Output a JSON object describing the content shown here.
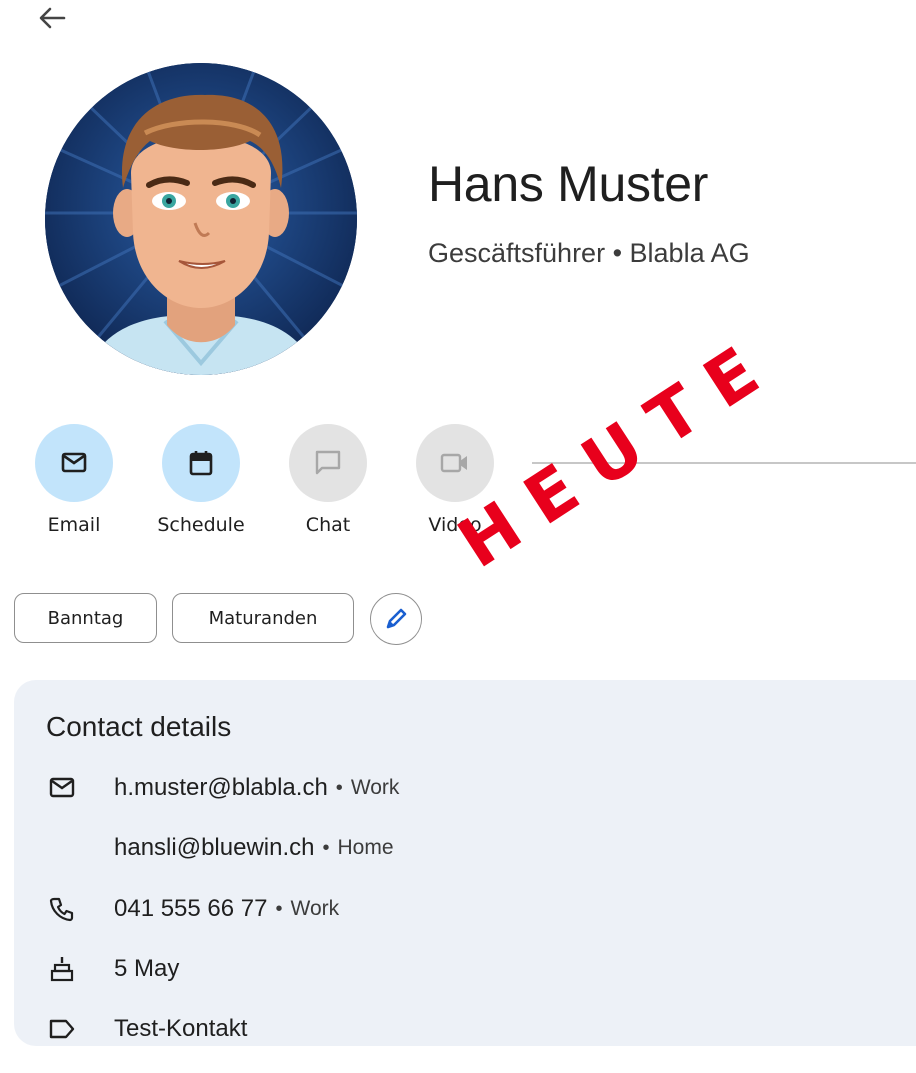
{
  "header": {
    "back_icon": "arrow-back-icon"
  },
  "contact": {
    "name": "Hans Muster",
    "subtitle": "Gescäftsführer • Blabla AG"
  },
  "actions": [
    {
      "label": "Email",
      "icon": "mail-icon",
      "enabled": true
    },
    {
      "label": "Schedule",
      "icon": "calendar-icon",
      "enabled": true
    },
    {
      "label": "Chat",
      "icon": "chat-icon",
      "enabled": false
    },
    {
      "label": "Video",
      "icon": "video-icon",
      "enabled": false
    }
  ],
  "labels": [
    {
      "label": "Banntag"
    },
    {
      "label": "Maturanden"
    }
  ],
  "edit_labels_icon": "pencil-icon",
  "stamp": {
    "text": "HEUTE",
    "color": "#e8001c"
  },
  "details": {
    "title": "Contact details",
    "rows": [
      {
        "icon": "mail-icon",
        "value": "h.muster@blabla.ch",
        "sep": "•",
        "tag": "Work"
      },
      {
        "icon": "",
        "value": "hansli@bluewin.ch",
        "sep": "•",
        "tag": "Home"
      },
      {
        "icon": "phone-icon",
        "value": "041 555 66 77",
        "sep": "•",
        "tag": "Work"
      },
      {
        "icon": "cake-icon",
        "value": "5 May"
      },
      {
        "icon": "label-icon",
        "value": "Test-Kontakt"
      }
    ]
  },
  "colors": {
    "action_enabled_bg": "#c2e4fb",
    "action_disabled_bg": "#e3e3e3",
    "card_bg": "#edf1f7",
    "edit_icon": "#1a5fd0"
  }
}
